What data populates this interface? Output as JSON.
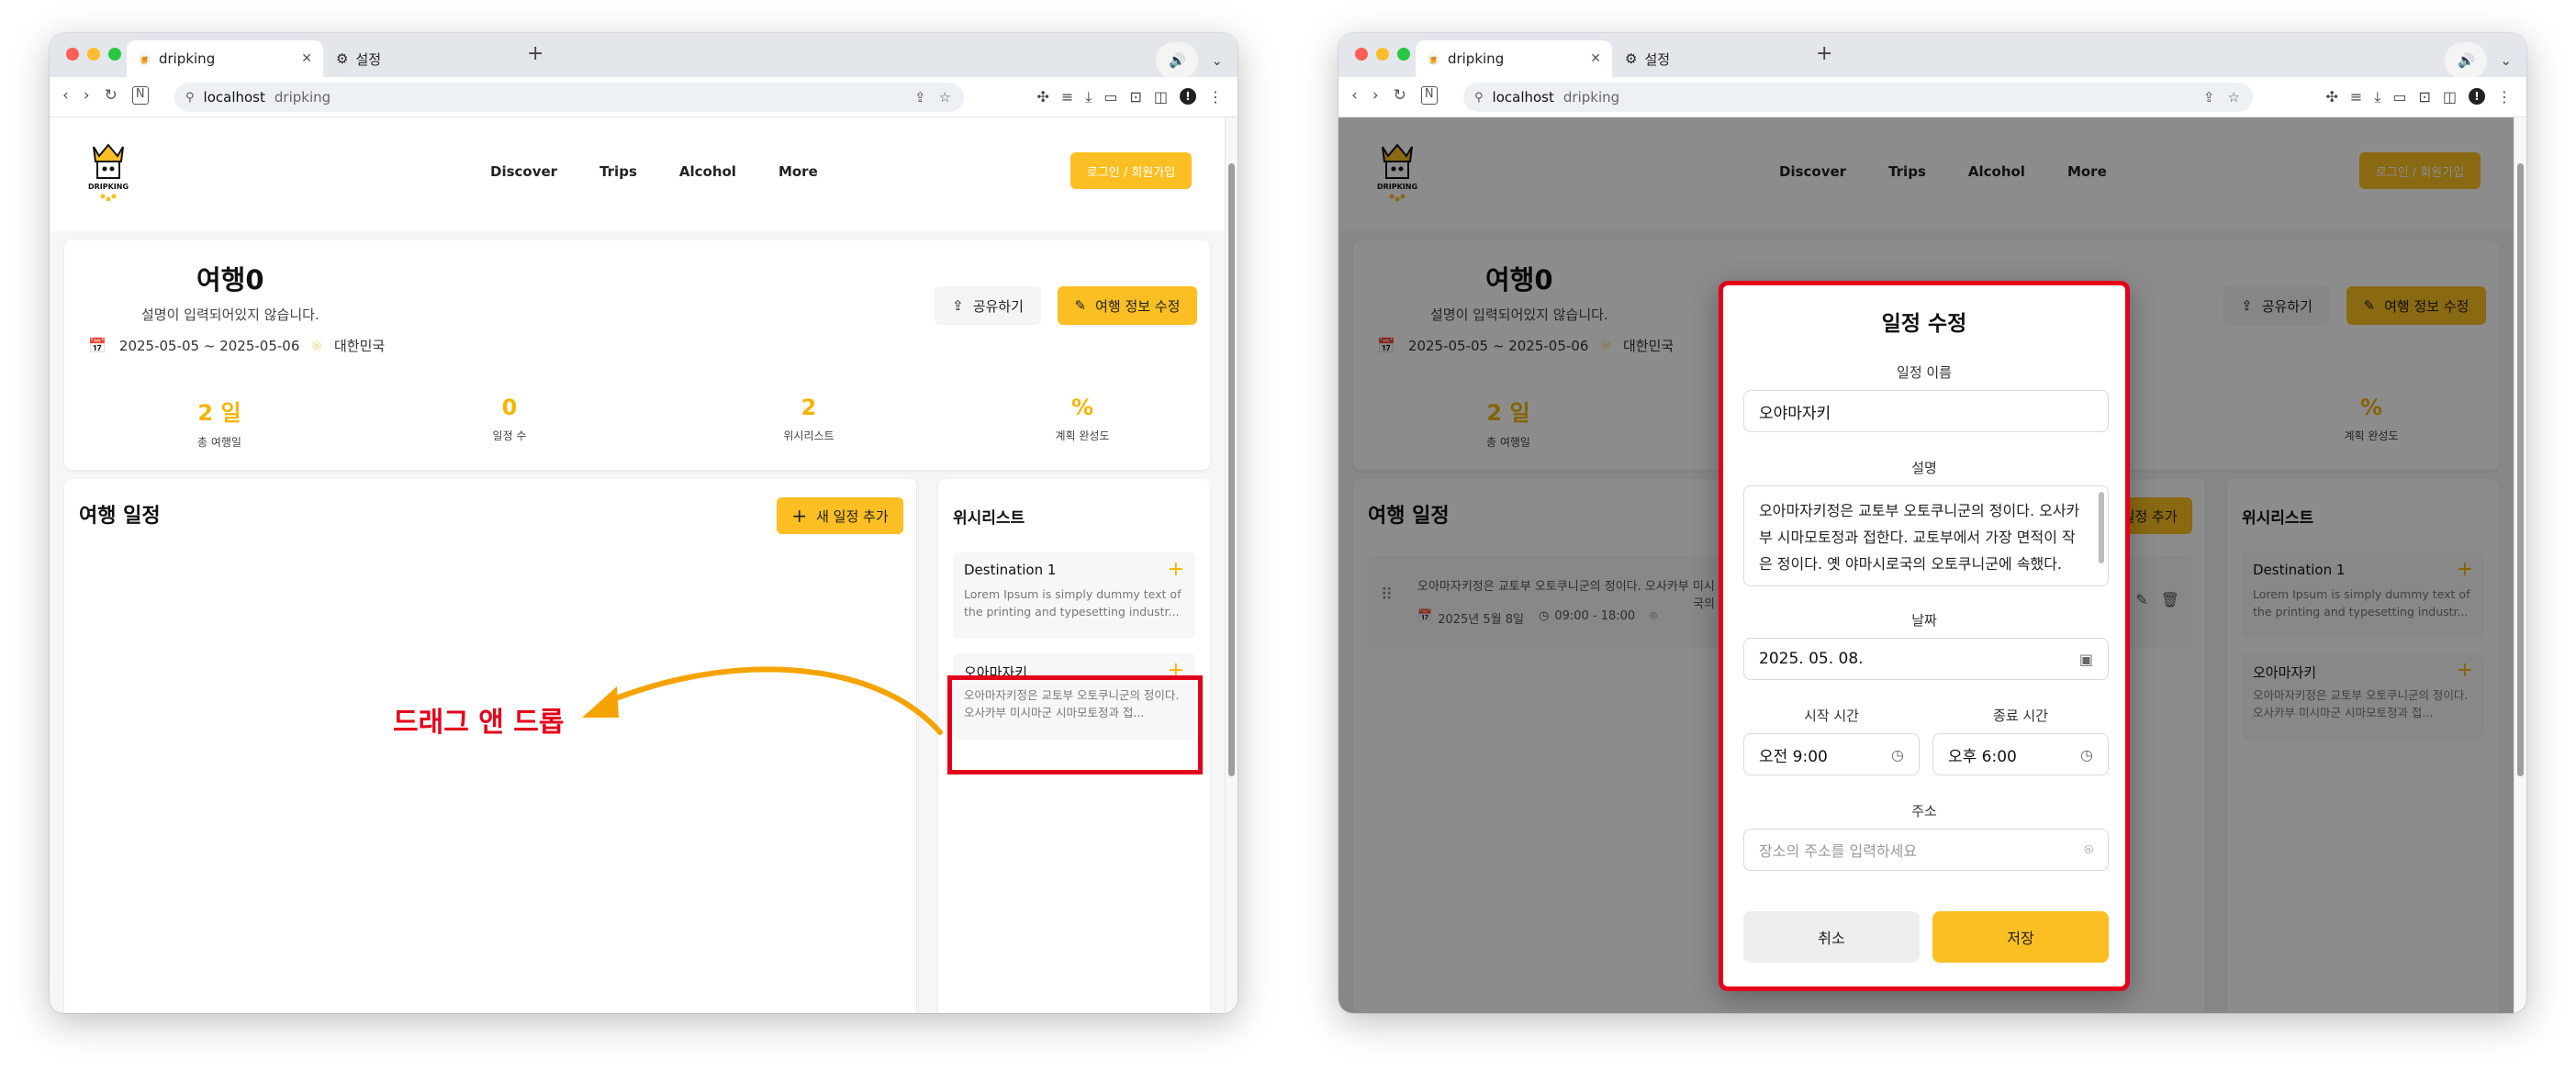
{
  "browser": {
    "tab_active": "dripking",
    "tab_inactive": "설정",
    "url_host": "localhost",
    "url_path": "dripking"
  },
  "site": {
    "logo_text": "DRIPKING",
    "nav": [
      "Discover",
      "Trips",
      "Alcohol",
      "More"
    ],
    "login_label": "로그인 / 회원가입"
  },
  "trip": {
    "title": "여행0",
    "description": "설명이 입력되어있지 않습니다.",
    "dates": "2025-05-05 ~ 2025-05-06",
    "country": "대한민국",
    "share_label": "공유하기",
    "edit_label": "여행 정보 수정",
    "stats": [
      {
        "value": "2 일",
        "label": "총 여행일"
      },
      {
        "value": "0",
        "label": "일정 수"
      },
      {
        "value": "2",
        "label": "위시리스트"
      },
      {
        "value": "%",
        "label": "계획 완성도"
      }
    ]
  },
  "schedule": {
    "title": "여행 일정",
    "add_label": "새 일정 추가",
    "item_text": "오아마자키정은 교토부 오토쿠니군의 정이다. 오사카부 미시",
    "item_text_tail": "국의",
    "item_date": "2025년 5월 8일",
    "item_time": "09:00 - 18:00"
  },
  "wishlist": {
    "title": "위시리스트",
    "items": [
      {
        "title": "Destination 1",
        "desc": "Lorem Ipsum is simply dummy text of the printing and typesetting industr..."
      },
      {
        "title": "오아마자키",
        "desc": "오아마자키정은 교토부 오토쿠니군의 정이다. 오사카부 미시마군 시마모토정과 접..."
      }
    ]
  },
  "annotation": {
    "label": "드래그 앤 드롭",
    "color": "#e3001b"
  },
  "modal": {
    "title": "일정 수정",
    "name_label": "일정 이름",
    "name_value": "오야마자키",
    "desc_label": "설명",
    "desc_value": "오아마자키정은 교토부 오토쿠니군의 정이다. 오사카부 시마모토정과 접한다. 교토부에서 가장 면적이 작은 정이다. 옛 야마시로국의 오토쿠니군에 속했다.",
    "date_label": "날짜",
    "date_value": "2025. 05. 08.",
    "start_label": "시작 시간",
    "start_value": "오전 9:00",
    "end_label": "종료 시간",
    "end_value": "오후 6:00",
    "addr_label": "주소",
    "addr_placeholder": "장소의 주소를 입력하세요",
    "cancel_label": "취소",
    "save_label": "저장"
  },
  "colors": {
    "accent": "#fbbf24",
    "accent_text": "#f4b400",
    "highlight": "#e3001b",
    "arrow": "#f5a300"
  }
}
